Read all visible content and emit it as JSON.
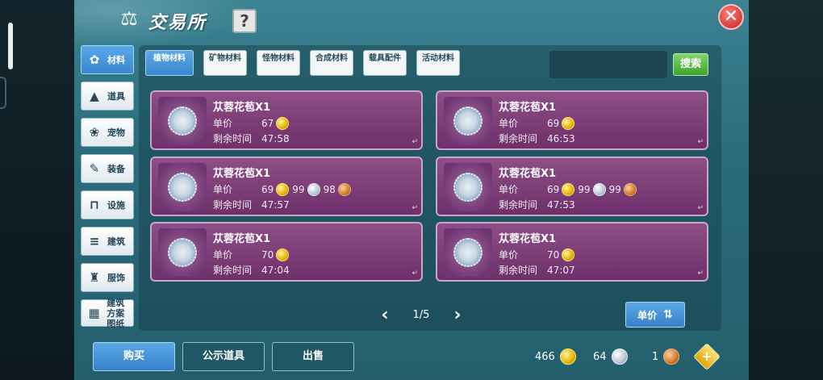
{
  "header": {
    "title": "交易所",
    "help_label": "?",
    "close_label": "✕"
  },
  "categories": [
    {
      "label": "材料",
      "icon": "materials-icon",
      "active": true
    },
    {
      "label": "道具",
      "icon": "item-icon",
      "active": false
    },
    {
      "label": "宠物",
      "icon": "paw-icon",
      "active": false
    },
    {
      "label": "装备",
      "icon": "equipment-icon",
      "active": false
    },
    {
      "label": "设施",
      "icon": "facility-icon",
      "active": false
    },
    {
      "label": "建筑",
      "icon": "building-icon",
      "active": false
    },
    {
      "label": "服饰",
      "icon": "clothing-icon",
      "active": false
    },
    {
      "label": "建筑方案图纸",
      "icon": "blueprint-icon",
      "active": false
    }
  ],
  "tabs": [
    {
      "label": "植物材料",
      "active": true
    },
    {
      "label": "矿物材料",
      "active": false
    },
    {
      "label": "怪物材料",
      "active": false
    },
    {
      "label": "合成材料",
      "active": false
    },
    {
      "label": "载具配件",
      "active": false
    },
    {
      "label": "活动材料",
      "active": false
    }
  ],
  "search": {
    "placeholder": "",
    "button_label": "搜索"
  },
  "labels": {
    "unit_price": "单价",
    "remaining_time": "剩余时间"
  },
  "listings": [
    {
      "name": "苁蓉花苞X1",
      "gold": "67",
      "silver": "",
      "copper": "",
      "time": "47:58"
    },
    {
      "name": "苁蓉花苞X1",
      "gold": "69",
      "silver": "",
      "copper": "",
      "time": "46:53"
    },
    {
      "name": "苁蓉花苞X1",
      "gold": "69",
      "silver": "99",
      "copper": "98",
      "time": "47:57"
    },
    {
      "name": "苁蓉花苞X1",
      "gold": "69",
      "silver": "99",
      "copper": "99",
      "time": "47:53"
    },
    {
      "name": "苁蓉花苞X1",
      "gold": "70",
      "silver": "",
      "copper": "",
      "time": "47:04"
    },
    {
      "name": "苁蓉花苞X1",
      "gold": "70",
      "silver": "",
      "copper": "",
      "time": "47:07"
    }
  ],
  "pager": {
    "text": "1/5"
  },
  "sort": {
    "label": "单价"
  },
  "footer": {
    "buy_label": "购买",
    "public_label": "公示道具",
    "sell_label": "出售",
    "gold": "466",
    "silver": "64",
    "copper": "1",
    "add_label": "+"
  },
  "colors": {
    "card": "#7e3f79",
    "panel": "#2f7383",
    "accent_blue": "#4a98dc",
    "search_green": "#4fb63e"
  }
}
